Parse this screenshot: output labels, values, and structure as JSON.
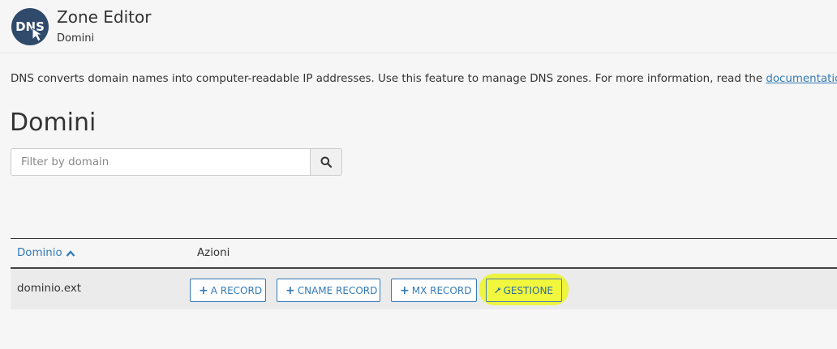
{
  "header": {
    "title": "Zone Editor",
    "subtitle": "Domini",
    "icon_text": "DNS",
    "icon_color": "#2f4a6b"
  },
  "description": {
    "text": "DNS converts domain names into computer-readable IP addresses. Use this feature to manage DNS zones. For more information, read the ",
    "link_text": "documentation",
    "suffix": "."
  },
  "section": {
    "title": "Domini"
  },
  "search": {
    "placeholder": "Filter by domain",
    "value": ""
  },
  "table": {
    "columns": {
      "domain": "Dominio",
      "actions": "Azioni"
    },
    "sort": "ascending",
    "rows": [
      {
        "domain": "dominio.ext",
        "buttons": {
          "a_record": "A RECORD",
          "cname_record": "CNAME RECORD",
          "mx_record": "MX RECORD",
          "manage": "GESTIONE"
        }
      }
    ]
  },
  "colors": {
    "link": "#337ab7",
    "highlight": "#eef52c"
  }
}
